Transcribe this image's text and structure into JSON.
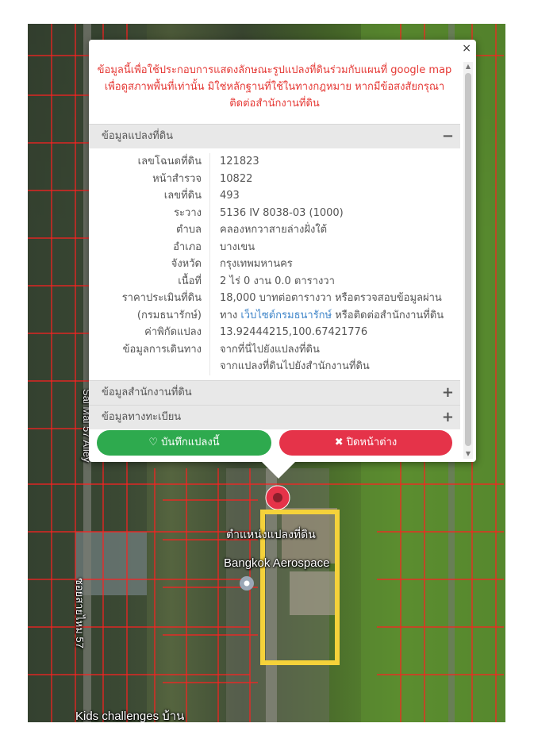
{
  "popup": {
    "close_glyph": "×",
    "notice": "ข้อมูลนี้เพื่อใช้ประกอบการแสดงลักษณะรูปแปลงที่ดินร่วมกับแผนที่ google map เพื่อดูสภาพพื้นที่เท่านั้น มิใช่หลักฐานที่ใช้ในทางกฎหมาย หากมีข้อสงสัยกรุณาติดต่อสำนักงานที่ดิน",
    "notice_color": "#e53935",
    "sections": {
      "land": {
        "title": "ข้อมูลแปลงที่ดิน",
        "sign": "−"
      },
      "office": {
        "title": "ข้อมูลสำนักงานที่ดิน",
        "sign": "+"
      },
      "registration": {
        "title": "ข้อมูลทางทะเบียน",
        "sign": "+"
      }
    },
    "rows": [
      {
        "label": "เลขโฉนดที่ดิน",
        "value": "121823"
      },
      {
        "label": "หน้าสำรวจ",
        "value": "10822"
      },
      {
        "label": "เลขที่ดิน",
        "value": "493"
      },
      {
        "label": "ระวาง",
        "value": "5136 IV 8038-03 (1000)"
      },
      {
        "label": "ตำบล",
        "value": "คลองหกวาสายล่างฝั่งใต้"
      },
      {
        "label": "อำเภอ",
        "value": "บางเขน"
      },
      {
        "label": "จังหวัด",
        "value": "กรุงเทพมหานคร"
      },
      {
        "label": "เนื้อที่",
        "value": "2 ไร่ 0 งาน 0.0 ตารางวา"
      }
    ],
    "price": {
      "label1": "ราคาประเมินที่ดิน",
      "label2": "(กรมธนารักษ์)",
      "value1": "18,000 บาทต่อตารางวา หรือตรวจสอบข้อมูลผ่าน",
      "value2_prefix": "ทาง ",
      "value2_link": "เว็บไซต์กรมธนารักษ์",
      "value2_suffix": " หรือติดต่อสำนักงานที่ดิน"
    },
    "coords": {
      "label": "ค่าพิกัดแปลง",
      "value": "13.92444215,100.67421776"
    },
    "directions": {
      "label": "ข้อมูลการเดินทาง",
      "link1": "จากที่นี่ไปยังแปลงที่ดิน",
      "link2": "จากแปลงที่ดินไปยังสำนักงานที่ดิน"
    },
    "save_label": "♡ บันทึกแปลงนี้",
    "close_label": "✖ ปิดหน้าต่าง",
    "save_color": "#2eaa4e",
    "close_color": "#e53349"
  },
  "map": {
    "parcel_label": "ตำแหน่งแปลงที่ดิน",
    "poi_label": "Bangkok Aerospace",
    "bottom_label": "Kids challenges บ้าน",
    "road_label_1": "Sai Mai 57 Alley",
    "road_label_2": "ซอยสายไหม 57",
    "marker_icon": "location-marker-icon",
    "highlight_color": "#f5d23a",
    "parcel_line_color": "#ff2020"
  }
}
